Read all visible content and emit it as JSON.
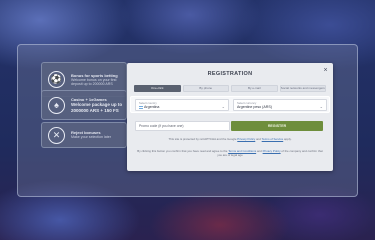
{
  "promos": [
    {
      "icon": "soccer-ball-icon",
      "title": "Bonus for sports betting",
      "description": "Welcome bonus on your first deposit up to 200000 ARS"
    },
    {
      "icon": "casino-chip-icon",
      "title": "Casino + 1xGames",
      "highlight": "Welcome package up to 2000000 ARS + 150 FS"
    },
    {
      "icon": "close-circle-icon",
      "title": "Reject bonuses",
      "description": "Make your selection later"
    }
  ],
  "registration": {
    "title": "REGISTRATION",
    "close_symbol": "×",
    "tabs": [
      {
        "label": "One-click",
        "active": true
      },
      {
        "label": "By phone",
        "active": false
      },
      {
        "label": "By e-mail",
        "active": false
      },
      {
        "label": "Social networks and messengers",
        "active": false
      }
    ],
    "country": {
      "label": "Select country",
      "value": "Argentina"
    },
    "currency": {
      "label": "Select currency",
      "value": "Argentine peso (ARS)"
    },
    "promo_placeholder": "Promo code (if you have one)",
    "register_label": "REGISTER",
    "recaptcha_note": {
      "prefix": "This site is protected by reCAPTCHA and the Google",
      "privacy": "Privacy Policy",
      "and": "and",
      "terms": "Terms of Service",
      "suffix": "apply."
    },
    "consent_note": {
      "prefix": "By clicking this button you confirm that you have read and agree to the",
      "terms": "Terms and Conditions",
      "and": "and",
      "privacy": "Privacy Policy",
      "suffix": "of the company and confirm that you are of legal age"
    }
  },
  "colors": {
    "register_button": "#6e8e3c",
    "active_tab": "#5a6170",
    "link": "#3a6fb0"
  }
}
